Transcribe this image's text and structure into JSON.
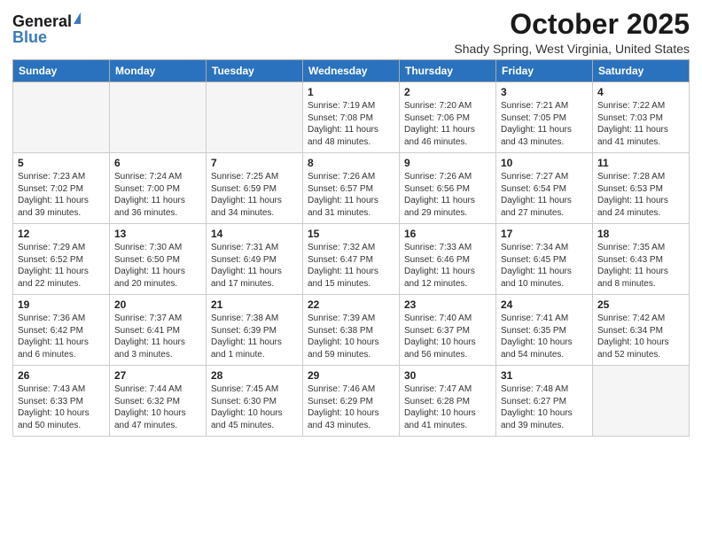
{
  "logo": {
    "general": "General",
    "blue": "Blue",
    "triangle_color": "#3a7abf"
  },
  "title": {
    "month": "October 2025",
    "location": "Shady Spring, West Virginia, United States"
  },
  "header_color": "#2a72be",
  "days_of_week": [
    "Sunday",
    "Monday",
    "Tuesday",
    "Wednesday",
    "Thursday",
    "Friday",
    "Saturday"
  ],
  "weeks": [
    [
      {
        "day": "",
        "info": ""
      },
      {
        "day": "",
        "info": ""
      },
      {
        "day": "",
        "info": ""
      },
      {
        "day": "1",
        "info": "Sunrise: 7:19 AM\nSunset: 7:08 PM\nDaylight: 11 hours\nand 48 minutes."
      },
      {
        "day": "2",
        "info": "Sunrise: 7:20 AM\nSunset: 7:06 PM\nDaylight: 11 hours\nand 46 minutes."
      },
      {
        "day": "3",
        "info": "Sunrise: 7:21 AM\nSunset: 7:05 PM\nDaylight: 11 hours\nand 43 minutes."
      },
      {
        "day": "4",
        "info": "Sunrise: 7:22 AM\nSunset: 7:03 PM\nDaylight: 11 hours\nand 41 minutes."
      }
    ],
    [
      {
        "day": "5",
        "info": "Sunrise: 7:23 AM\nSunset: 7:02 PM\nDaylight: 11 hours\nand 39 minutes."
      },
      {
        "day": "6",
        "info": "Sunrise: 7:24 AM\nSunset: 7:00 PM\nDaylight: 11 hours\nand 36 minutes."
      },
      {
        "day": "7",
        "info": "Sunrise: 7:25 AM\nSunset: 6:59 PM\nDaylight: 11 hours\nand 34 minutes."
      },
      {
        "day": "8",
        "info": "Sunrise: 7:26 AM\nSunset: 6:57 PM\nDaylight: 11 hours\nand 31 minutes."
      },
      {
        "day": "9",
        "info": "Sunrise: 7:26 AM\nSunset: 6:56 PM\nDaylight: 11 hours\nand 29 minutes."
      },
      {
        "day": "10",
        "info": "Sunrise: 7:27 AM\nSunset: 6:54 PM\nDaylight: 11 hours\nand 27 minutes."
      },
      {
        "day": "11",
        "info": "Sunrise: 7:28 AM\nSunset: 6:53 PM\nDaylight: 11 hours\nand 24 minutes."
      }
    ],
    [
      {
        "day": "12",
        "info": "Sunrise: 7:29 AM\nSunset: 6:52 PM\nDaylight: 11 hours\nand 22 minutes."
      },
      {
        "day": "13",
        "info": "Sunrise: 7:30 AM\nSunset: 6:50 PM\nDaylight: 11 hours\nand 20 minutes."
      },
      {
        "day": "14",
        "info": "Sunrise: 7:31 AM\nSunset: 6:49 PM\nDaylight: 11 hours\nand 17 minutes."
      },
      {
        "day": "15",
        "info": "Sunrise: 7:32 AM\nSunset: 6:47 PM\nDaylight: 11 hours\nand 15 minutes."
      },
      {
        "day": "16",
        "info": "Sunrise: 7:33 AM\nSunset: 6:46 PM\nDaylight: 11 hours\nand 12 minutes."
      },
      {
        "day": "17",
        "info": "Sunrise: 7:34 AM\nSunset: 6:45 PM\nDaylight: 11 hours\nand 10 minutes."
      },
      {
        "day": "18",
        "info": "Sunrise: 7:35 AM\nSunset: 6:43 PM\nDaylight: 11 hours\nand 8 minutes."
      }
    ],
    [
      {
        "day": "19",
        "info": "Sunrise: 7:36 AM\nSunset: 6:42 PM\nDaylight: 11 hours\nand 6 minutes."
      },
      {
        "day": "20",
        "info": "Sunrise: 7:37 AM\nSunset: 6:41 PM\nDaylight: 11 hours\nand 3 minutes."
      },
      {
        "day": "21",
        "info": "Sunrise: 7:38 AM\nSunset: 6:39 PM\nDaylight: 11 hours\nand 1 minute."
      },
      {
        "day": "22",
        "info": "Sunrise: 7:39 AM\nSunset: 6:38 PM\nDaylight: 10 hours\nand 59 minutes."
      },
      {
        "day": "23",
        "info": "Sunrise: 7:40 AM\nSunset: 6:37 PM\nDaylight: 10 hours\nand 56 minutes."
      },
      {
        "day": "24",
        "info": "Sunrise: 7:41 AM\nSunset: 6:35 PM\nDaylight: 10 hours\nand 54 minutes."
      },
      {
        "day": "25",
        "info": "Sunrise: 7:42 AM\nSunset: 6:34 PM\nDaylight: 10 hours\nand 52 minutes."
      }
    ],
    [
      {
        "day": "26",
        "info": "Sunrise: 7:43 AM\nSunset: 6:33 PM\nDaylight: 10 hours\nand 50 minutes."
      },
      {
        "day": "27",
        "info": "Sunrise: 7:44 AM\nSunset: 6:32 PM\nDaylight: 10 hours\nand 47 minutes."
      },
      {
        "day": "28",
        "info": "Sunrise: 7:45 AM\nSunset: 6:30 PM\nDaylight: 10 hours\nand 45 minutes."
      },
      {
        "day": "29",
        "info": "Sunrise: 7:46 AM\nSunset: 6:29 PM\nDaylight: 10 hours\nand 43 minutes."
      },
      {
        "day": "30",
        "info": "Sunrise: 7:47 AM\nSunset: 6:28 PM\nDaylight: 10 hours\nand 41 minutes."
      },
      {
        "day": "31",
        "info": "Sunrise: 7:48 AM\nSunset: 6:27 PM\nDaylight: 10 hours\nand 39 minutes."
      },
      {
        "day": "",
        "info": ""
      }
    ]
  ]
}
